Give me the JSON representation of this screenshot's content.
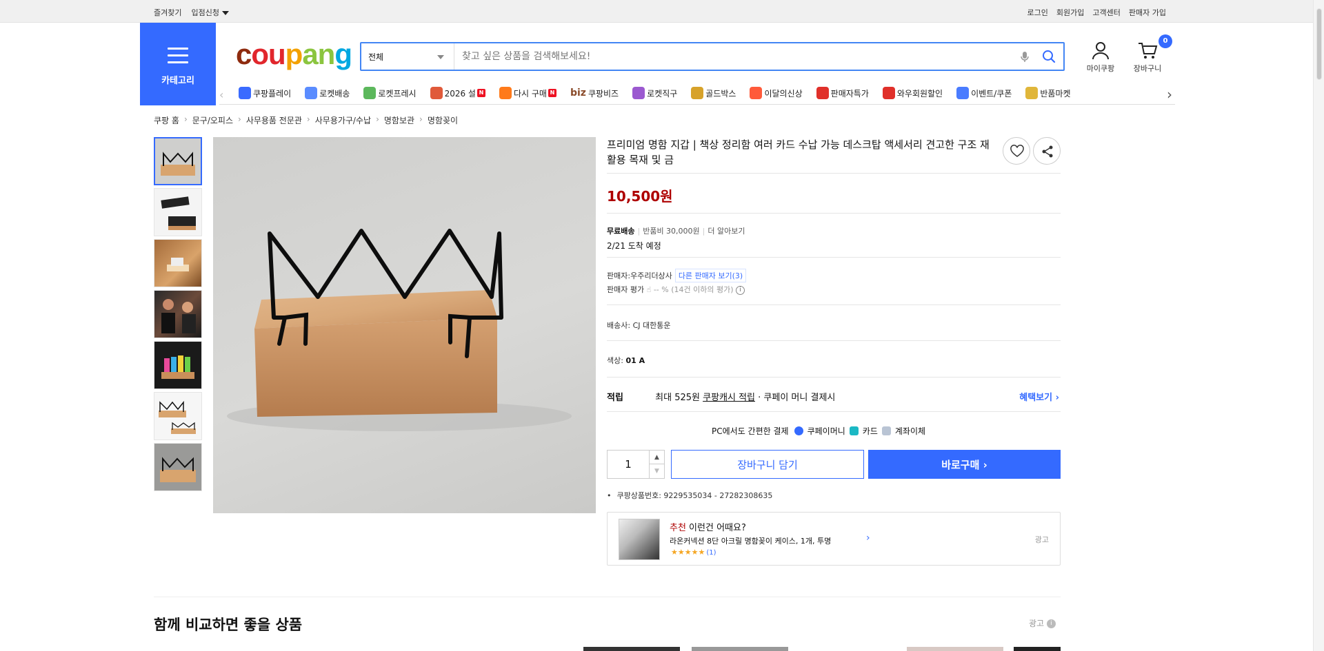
{
  "topbar": {
    "bookmark": "즐겨찾기",
    "store_apply": "입점신청",
    "login": "로그인",
    "signup": "회원가입",
    "customer_center": "고객센터",
    "seller_signup": "판매자 가입"
  },
  "header": {
    "category_label": "카테고리",
    "logo": [
      "c",
      "ou",
      "p",
      "an",
      "g"
    ],
    "search_category": "전체",
    "search_placeholder": "찾고 싶은 상품을 검색해보세요!",
    "mycoupang": "마이쿠팡",
    "cart": "장바구니",
    "cart_count": "0"
  },
  "nav": {
    "items": [
      {
        "label": "쿠팡플레이",
        "icon": "play-icon",
        "color": "#3a6bff"
      },
      {
        "label": "로켓배송",
        "icon": "rocket-icon",
        "color": "#5a8cff"
      },
      {
        "label": "로켓프레시",
        "icon": "rocket-fresh-icon",
        "color": "#5cb85c"
      },
      {
        "label": "2026 설",
        "icon": "gift-icon",
        "color": "#e05a3a",
        "badge": "N"
      },
      {
        "label": "다시 구매",
        "icon": "repurchase-icon",
        "color": "#ff7a1a",
        "badge": "N"
      },
      {
        "label": "쿠팡비즈",
        "icon": "biz-icon",
        "color": "#8a4b2a",
        "prefix": "biz"
      },
      {
        "label": "로켓직구",
        "icon": "global-icon",
        "color": "#9b59d0"
      },
      {
        "label": "골드박스",
        "icon": "goldbox-icon",
        "color": "#d7a22a"
      },
      {
        "label": "이달의신상",
        "icon": "new-icon",
        "color": "#ff5a3a"
      },
      {
        "label": "판매자특가",
        "icon": "percent-icon",
        "color": "#e0302a"
      },
      {
        "label": "와우회원할인",
        "icon": "wow-icon",
        "color": "#e0302a"
      },
      {
        "label": "이벤트/쿠폰",
        "icon": "coupon-icon",
        "color": "#4a7cff"
      },
      {
        "label": "반품마켓",
        "icon": "market-icon",
        "color": "#e0b63a"
      }
    ]
  },
  "breadcrumb": [
    "쿠팡 홈",
    "문구/오피스",
    "사무용품 전문관",
    "사무용가구/수납",
    "명함보관",
    "명함꽂이"
  ],
  "product": {
    "title": "프리미엄 명함 지갑 | 책상 정리함 여러 카드 수납 가능 데스크탑 액세서리 견고한 구조 재활용 목재 및 금",
    "price": "10,500원",
    "shipping": {
      "free": "무료배송",
      "return_fee": "반품비 30,000원",
      "more": "더 알아보기",
      "arrival": "2/21 도착 예정"
    },
    "seller": {
      "label": "판매자: ",
      "name": "우주리더상사",
      "other": "다른 판매자 보기(3)",
      "rating_label": "판매자 평가",
      "rating_value": "-- %",
      "rating_note": "(14건 이하의 평가)"
    },
    "courier_label": "배송사: ",
    "courier": "CJ 대한통운",
    "color_label": "색상: ",
    "color": "01 A",
    "reward": {
      "label": "적립",
      "text1": "최대 525원",
      "text2": "쿠팡캐시 적립",
      "text3": "· 쿠페이 머니 결제시",
      "benefit": "혜택보기"
    },
    "easy_pay": {
      "label": "PC에서도 간편한 결제",
      "coupay": "쿠페이머니",
      "card": "카드",
      "transfer": "계좌이체"
    },
    "quantity": "1",
    "add_to_cart": "장바구니 담기",
    "buy_now": "바로구매",
    "product_number": "쿠팡상품번호: 9229535034 - 27282308635"
  },
  "recommend": {
    "highlight": "추천",
    "head": " 이런건 어때요?",
    "name": "라온커넥션 8단 아크릴 명함꽂이 케이스, 1개, 투명",
    "stars": "★★★★★",
    "count": "(1)",
    "ad": "광고"
  },
  "compare": {
    "title": "함께 비교하면 좋을 상품",
    "ad": "광고"
  },
  "colors": {
    "accent": "#346aff",
    "price": "#ae0000"
  }
}
